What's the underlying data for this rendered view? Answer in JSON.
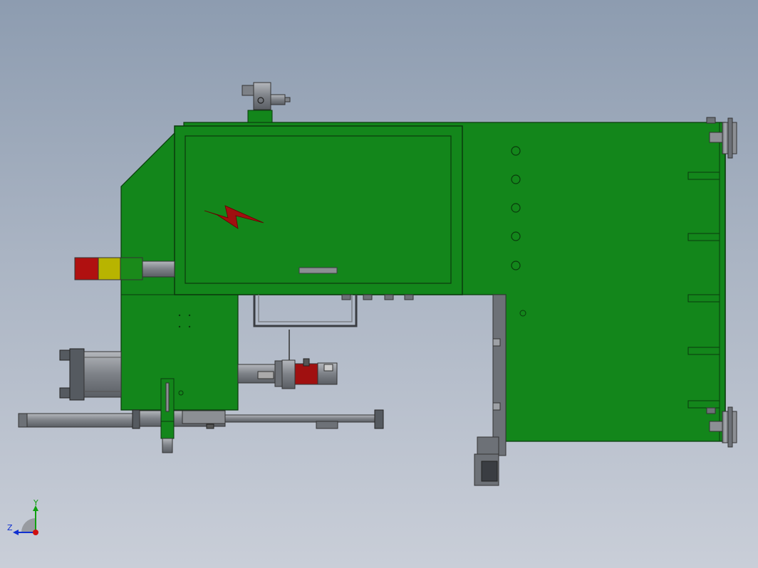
{
  "viewport": {
    "background_top": "#8d9cb0",
    "background_bottom": "#c9ced8"
  },
  "model": {
    "body_color": "#13861b",
    "edge_color": "#0a3a0c",
    "metal_color": "#8c8f94",
    "dark_metal_color": "#555a60",
    "signal_lamp_colors": [
      "#b01010",
      "#b8b400",
      "#1a8a1a"
    ],
    "motor_color": "#a01010",
    "warning_symbol": "high-voltage-bolt",
    "warning_symbol_color": "#a01010"
  },
  "triad": {
    "x_color": "#d01010",
    "y_color": "#10a010",
    "z_color": "#1030d0",
    "labels": {
      "y": "Y",
      "z": "Z"
    }
  }
}
